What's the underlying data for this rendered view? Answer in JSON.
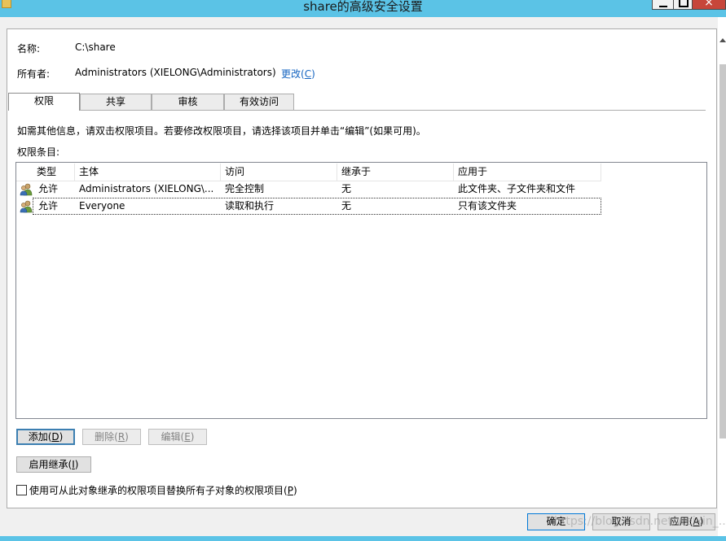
{
  "window": {
    "title": "share的高级安全设置"
  },
  "info": {
    "name_label": "名称:",
    "name_value": "C:\\share",
    "owner_label": "所有者:",
    "owner_value": "Administrators (XIELONG\\Administrators)",
    "change_link_text": "更改(",
    "change_link_key": "C",
    "change_link_end": ")"
  },
  "tabs": [
    {
      "label": "权限",
      "active": true
    },
    {
      "label": "共享",
      "active": false
    },
    {
      "label": "审核",
      "active": false
    },
    {
      "label": "有效访问",
      "active": false
    }
  ],
  "instruction": "如需其他信息，请双击权限项目。若要修改权限项目，请选择该项目并单击“编辑”(如果可用)。",
  "entries_label": "权限条目:",
  "table": {
    "columns": [
      "类型",
      "主体",
      "访问",
      "继承于",
      "应用于"
    ],
    "rows": [
      {
        "type": "允许",
        "principal": "Administrators (XIELONG\\...",
        "access": "完全控制",
        "inherited": "无",
        "applies": "此文件夹、子文件夹和文件",
        "selected": false
      },
      {
        "type": "允许",
        "principal": "Everyone",
        "access": "读取和执行",
        "inherited": "无",
        "applies": "只有该文件夹",
        "selected": true
      }
    ]
  },
  "buttons": {
    "add": {
      "label": "添加(",
      "key": "D",
      "end": ")"
    },
    "remove": {
      "label": "删除(",
      "key": "R",
      "end": ")"
    },
    "edit": {
      "label": "编辑(",
      "key": "E",
      "end": ")"
    },
    "enable_inheritance": {
      "label": "启用继承(",
      "key": "I",
      "end": ")"
    },
    "ok": {
      "label": "确定"
    },
    "cancel": {
      "label": "取消"
    },
    "apply": {
      "label": "应用(",
      "key": "A",
      "end": ")"
    }
  },
  "replace_checkbox": {
    "label": "使用可从此对象继承的权限项目替换所有子对象的权限项目(",
    "key": "P",
    "end": ")",
    "checked": false
  },
  "watermark": "https://blog.csdn.net/weixin_..."
}
